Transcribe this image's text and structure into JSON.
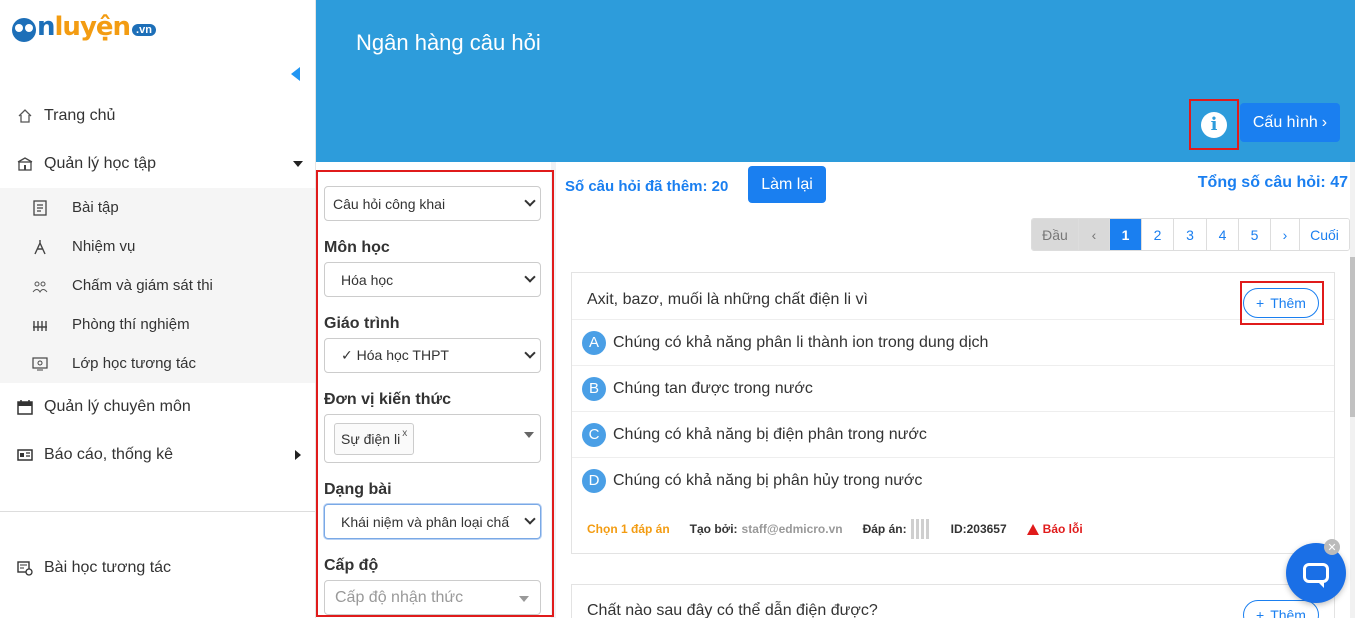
{
  "logo": {
    "text_prefix": "n",
    "text_main": "luyện",
    "suffix": ".vn"
  },
  "sidebar": {
    "items": [
      {
        "label": "Trang chủ",
        "icon": "home-icon"
      },
      {
        "label": "Quản lý học tập",
        "icon": "school-icon"
      },
      {
        "label": "Quản lý chuyên môn",
        "icon": "calendar-icon"
      },
      {
        "label": "Báo cáo, thống kê",
        "icon": "report-icon"
      }
    ],
    "sub_items": [
      {
        "label": "Bài tập",
        "icon": "exercise-icon"
      },
      {
        "label": "Nhiệm vụ",
        "icon": "compass-icon"
      },
      {
        "label": "Chấm và giám sát thi",
        "icon": "proctor-icon"
      },
      {
        "label": "Phòng thí nghiệm",
        "icon": "lab-icon"
      },
      {
        "label": "Lớp học tương tác",
        "icon": "interactive-class-icon"
      }
    ],
    "bottom_item": {
      "label": "Bài học tương tác",
      "icon": "interactive-lesson-icon"
    }
  },
  "header": {
    "title": "Ngân hàng câu hỏi",
    "config_label": "Cấu hình",
    "config_chevron": "›",
    "info_glyph": "i"
  },
  "filter": {
    "scope": "Câu hỏi công khai",
    "subject_label": "Môn học",
    "subject": "Hóa học",
    "curriculum_label": "Giáo trình",
    "curriculum": "✓ Hóa học THPT",
    "unit_label": "Đơn vị kiến thức",
    "unit_tag": "Sự điện li",
    "unit_tag_remove": "x",
    "type_label": "Dạng bài",
    "type": "Khái niệm và phân loại chấ",
    "level_label": "Cấp độ",
    "level_placeholder": "Cấp độ nhận thức"
  },
  "summary": {
    "added_text": "Số câu hỏi đã thêm: 20",
    "reset_label": "Làm lại",
    "total_text": "Tổng số câu hỏi: 47"
  },
  "pagination": {
    "first": "Đầu",
    "prev": "‹",
    "pages": [
      "1",
      "2",
      "3",
      "4",
      "5"
    ],
    "current": "1",
    "next": "›",
    "last": "Cuối"
  },
  "questions": [
    {
      "text": "Axit, bazơ, muối là những chất điện li vì",
      "add_label": "Thêm",
      "add_plus": "+",
      "answers": [
        {
          "letter": "A",
          "text": "Chúng có khả năng phân li thành ion trong dung dịch"
        },
        {
          "letter": "B",
          "text": "Chúng tan được trong nước"
        },
        {
          "letter": "C",
          "text": "Chúng có khả năng bị điện phân trong nước"
        },
        {
          "letter": "D",
          "text": "Chúng có khả năng bị phân hủy trong nước"
        }
      ],
      "meta": {
        "choose": "Chọn 1 đáp án",
        "created_label": "Tạo bởi:",
        "created_by": "staff@edmicro.vn",
        "answer_label": "Đáp án:",
        "id": "ID:203657",
        "report": "Báo lỗi"
      }
    },
    {
      "text": "Chất nào sau đây có thể dẫn điện được?",
      "add_label": "Thêm",
      "add_plus": "+"
    }
  ],
  "colors": {
    "header_bg": "#2d9cdb",
    "primary": "#1a7ff0",
    "highlight_red": "#e01b1b",
    "orange": "#f39c12"
  }
}
